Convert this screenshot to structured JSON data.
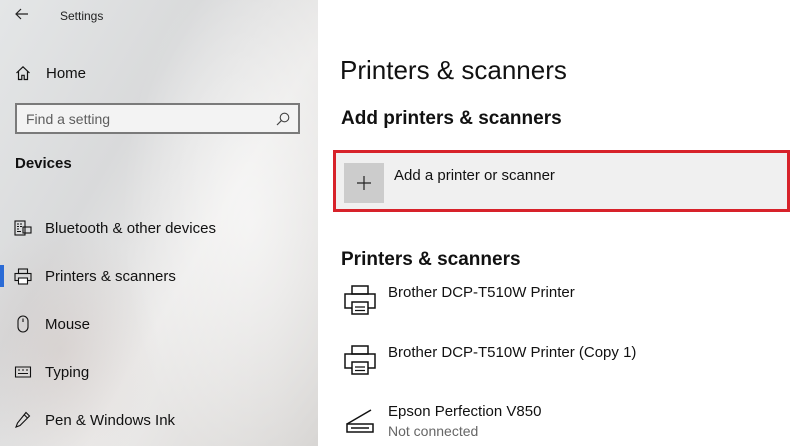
{
  "window": {
    "title": "Settings"
  },
  "sidebar": {
    "home_label": "Home",
    "search": {
      "placeholder": "Find a setting"
    },
    "section_title": "Devices",
    "items": [
      {
        "label": "Bluetooth & other devices",
        "icon": "keyboard-icon",
        "selected": false
      },
      {
        "label": "Printers & scanners",
        "icon": "printer-icon",
        "selected": true
      },
      {
        "label": "Mouse",
        "icon": "mouse-icon",
        "selected": false
      },
      {
        "label": "Typing",
        "icon": "typing-icon",
        "selected": false
      },
      {
        "label": "Pen & Windows Ink",
        "icon": "pen-icon",
        "selected": false
      }
    ]
  },
  "main": {
    "page_title": "Printers & scanners",
    "add_section_title": "Add printers & scanners",
    "add_button_label": "Add a printer or scanner",
    "list_title": "Printers & scanners",
    "devices": [
      {
        "name": "Brother DCP-T510W Printer",
        "status": "",
        "icon": "printer-icon"
      },
      {
        "name": "Brother DCP-T510W Printer (Copy 1)",
        "status": "",
        "icon": "printer-icon"
      },
      {
        "name": "Epson Perfection V850",
        "status": "Not connected",
        "icon": "scanner-icon"
      }
    ]
  },
  "colors": {
    "accent": "#2b6bd6",
    "highlight_border": "#d7222a"
  }
}
